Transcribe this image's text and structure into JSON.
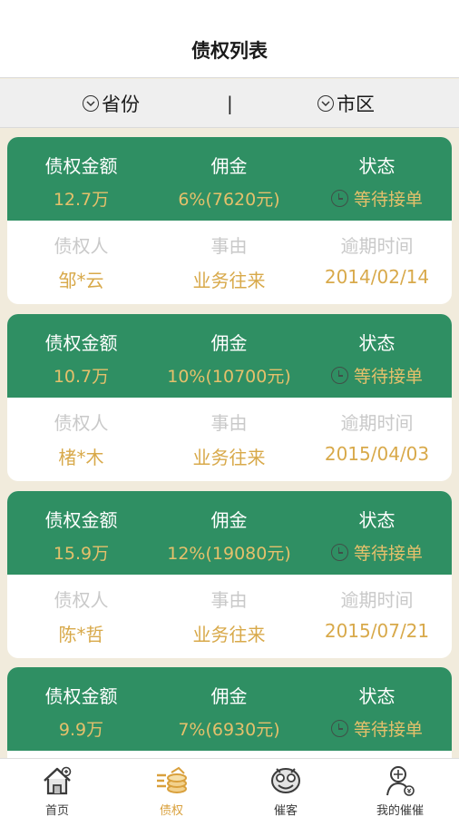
{
  "header": {
    "title": "债权列表"
  },
  "filters": {
    "province": "省份",
    "city": "市区",
    "divider": "|"
  },
  "card_labels": {
    "amount": "债权金额",
    "commission": "佣金",
    "status": "状态",
    "creditor": "债权人",
    "reason": "事由",
    "overdue": "逾期时间"
  },
  "cards": [
    {
      "amount": "12.7万",
      "commission": "6%(7620元)",
      "status": "等待接单",
      "creditor": "邹*云",
      "reason": "业务往来",
      "overdue": "2014/02/14"
    },
    {
      "amount": "10.7万",
      "commission": "10%(10700元)",
      "status": "等待接单",
      "creditor": "楮*木",
      "reason": "业务往来",
      "overdue": "2015/04/03"
    },
    {
      "amount": "15.9万",
      "commission": "12%(19080元)",
      "status": "等待接单",
      "creditor": "陈*哲",
      "reason": "业务往来",
      "overdue": "2015/07/21"
    },
    {
      "amount": "9.9万",
      "commission": "7%(6930元)",
      "status": "等待接单",
      "creditor": "",
      "reason": "",
      "overdue": ""
    }
  ],
  "tabs": [
    {
      "label": "首页",
      "icon": "home-icon"
    },
    {
      "label": "债权",
      "icon": "coins-icon"
    },
    {
      "label": "催客",
      "icon": "collector-icon"
    },
    {
      "label": "我的催催",
      "icon": "profile-icon"
    }
  ],
  "colors": {
    "card_green": "#2f8f63",
    "gold": "#d8a94a",
    "active_tab": "#d9a03c",
    "background": "#f1ebdc"
  }
}
